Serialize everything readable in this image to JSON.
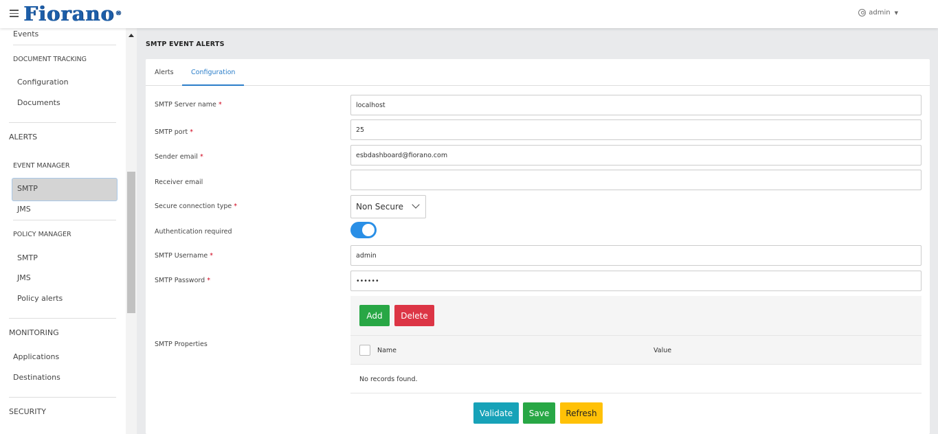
{
  "header": {
    "logo_text": "Fiorano",
    "logo_mark": "®",
    "user_label": "admin",
    "menu_icon": "hamburger-icon",
    "user_icon": "user-circle-icon",
    "dropdown_icon": "caret-down-icon",
    "brand_color": "#1d5ea8"
  },
  "sidebar": {
    "events": "Events",
    "document_tracking": "DOCUMENT TRACKING",
    "configuration": "Configuration",
    "documents": "Documents",
    "alerts": "ALERTS",
    "event_manager": "EVENT MANAGER",
    "smtp": "SMTP",
    "jms": "JMS",
    "policy_manager": "POLICY MANAGER",
    "policy_smtp": "SMTP",
    "policy_jms": "JMS",
    "policy_alerts": "Policy alerts",
    "monitoring": "MONITORING",
    "applications": "Applications",
    "destinations": "Destinations",
    "security": "SECURITY",
    "active_item": "SMTP"
  },
  "page": {
    "title": "SMTP EVENT ALERTS",
    "tabs": [
      {
        "label": "Alerts",
        "active": false
      },
      {
        "label": "Configuration",
        "active": true
      }
    ],
    "accent_color": "#2a7dc9"
  },
  "form": {
    "server_name": {
      "label": "SMTP Server name",
      "required": "*",
      "value": "localhost"
    },
    "port": {
      "label": "SMTP port",
      "required": "*",
      "value": "25"
    },
    "sender_email": {
      "label": "Sender email",
      "required": "*",
      "value": "esbdashboard@fiorano.com"
    },
    "receiver_email": {
      "label": "Receiver email",
      "value": ""
    },
    "secure_connection": {
      "label": "Secure connection type",
      "required": "*",
      "value": "Non Secure"
    },
    "auth_required": {
      "label": "Authentication required",
      "value": true
    },
    "username": {
      "label": "SMTP Username",
      "required": "*",
      "value": "admin"
    },
    "password": {
      "label": "SMTP Password",
      "required": "*",
      "value": "••••••"
    },
    "properties": {
      "label": "SMTP Properties",
      "add_label": "Add",
      "delete_label": "Delete",
      "columns": [
        "Name",
        "Value"
      ],
      "empty_message": "No records found."
    }
  },
  "actions": {
    "validate": "Validate",
    "save": "Save",
    "refresh": "Refresh"
  },
  "colors": {
    "success": "#28a745",
    "danger": "#dc3545",
    "info": "#17a2b8",
    "warning": "#ffc107",
    "toggle_on": "#2a8fe6"
  }
}
